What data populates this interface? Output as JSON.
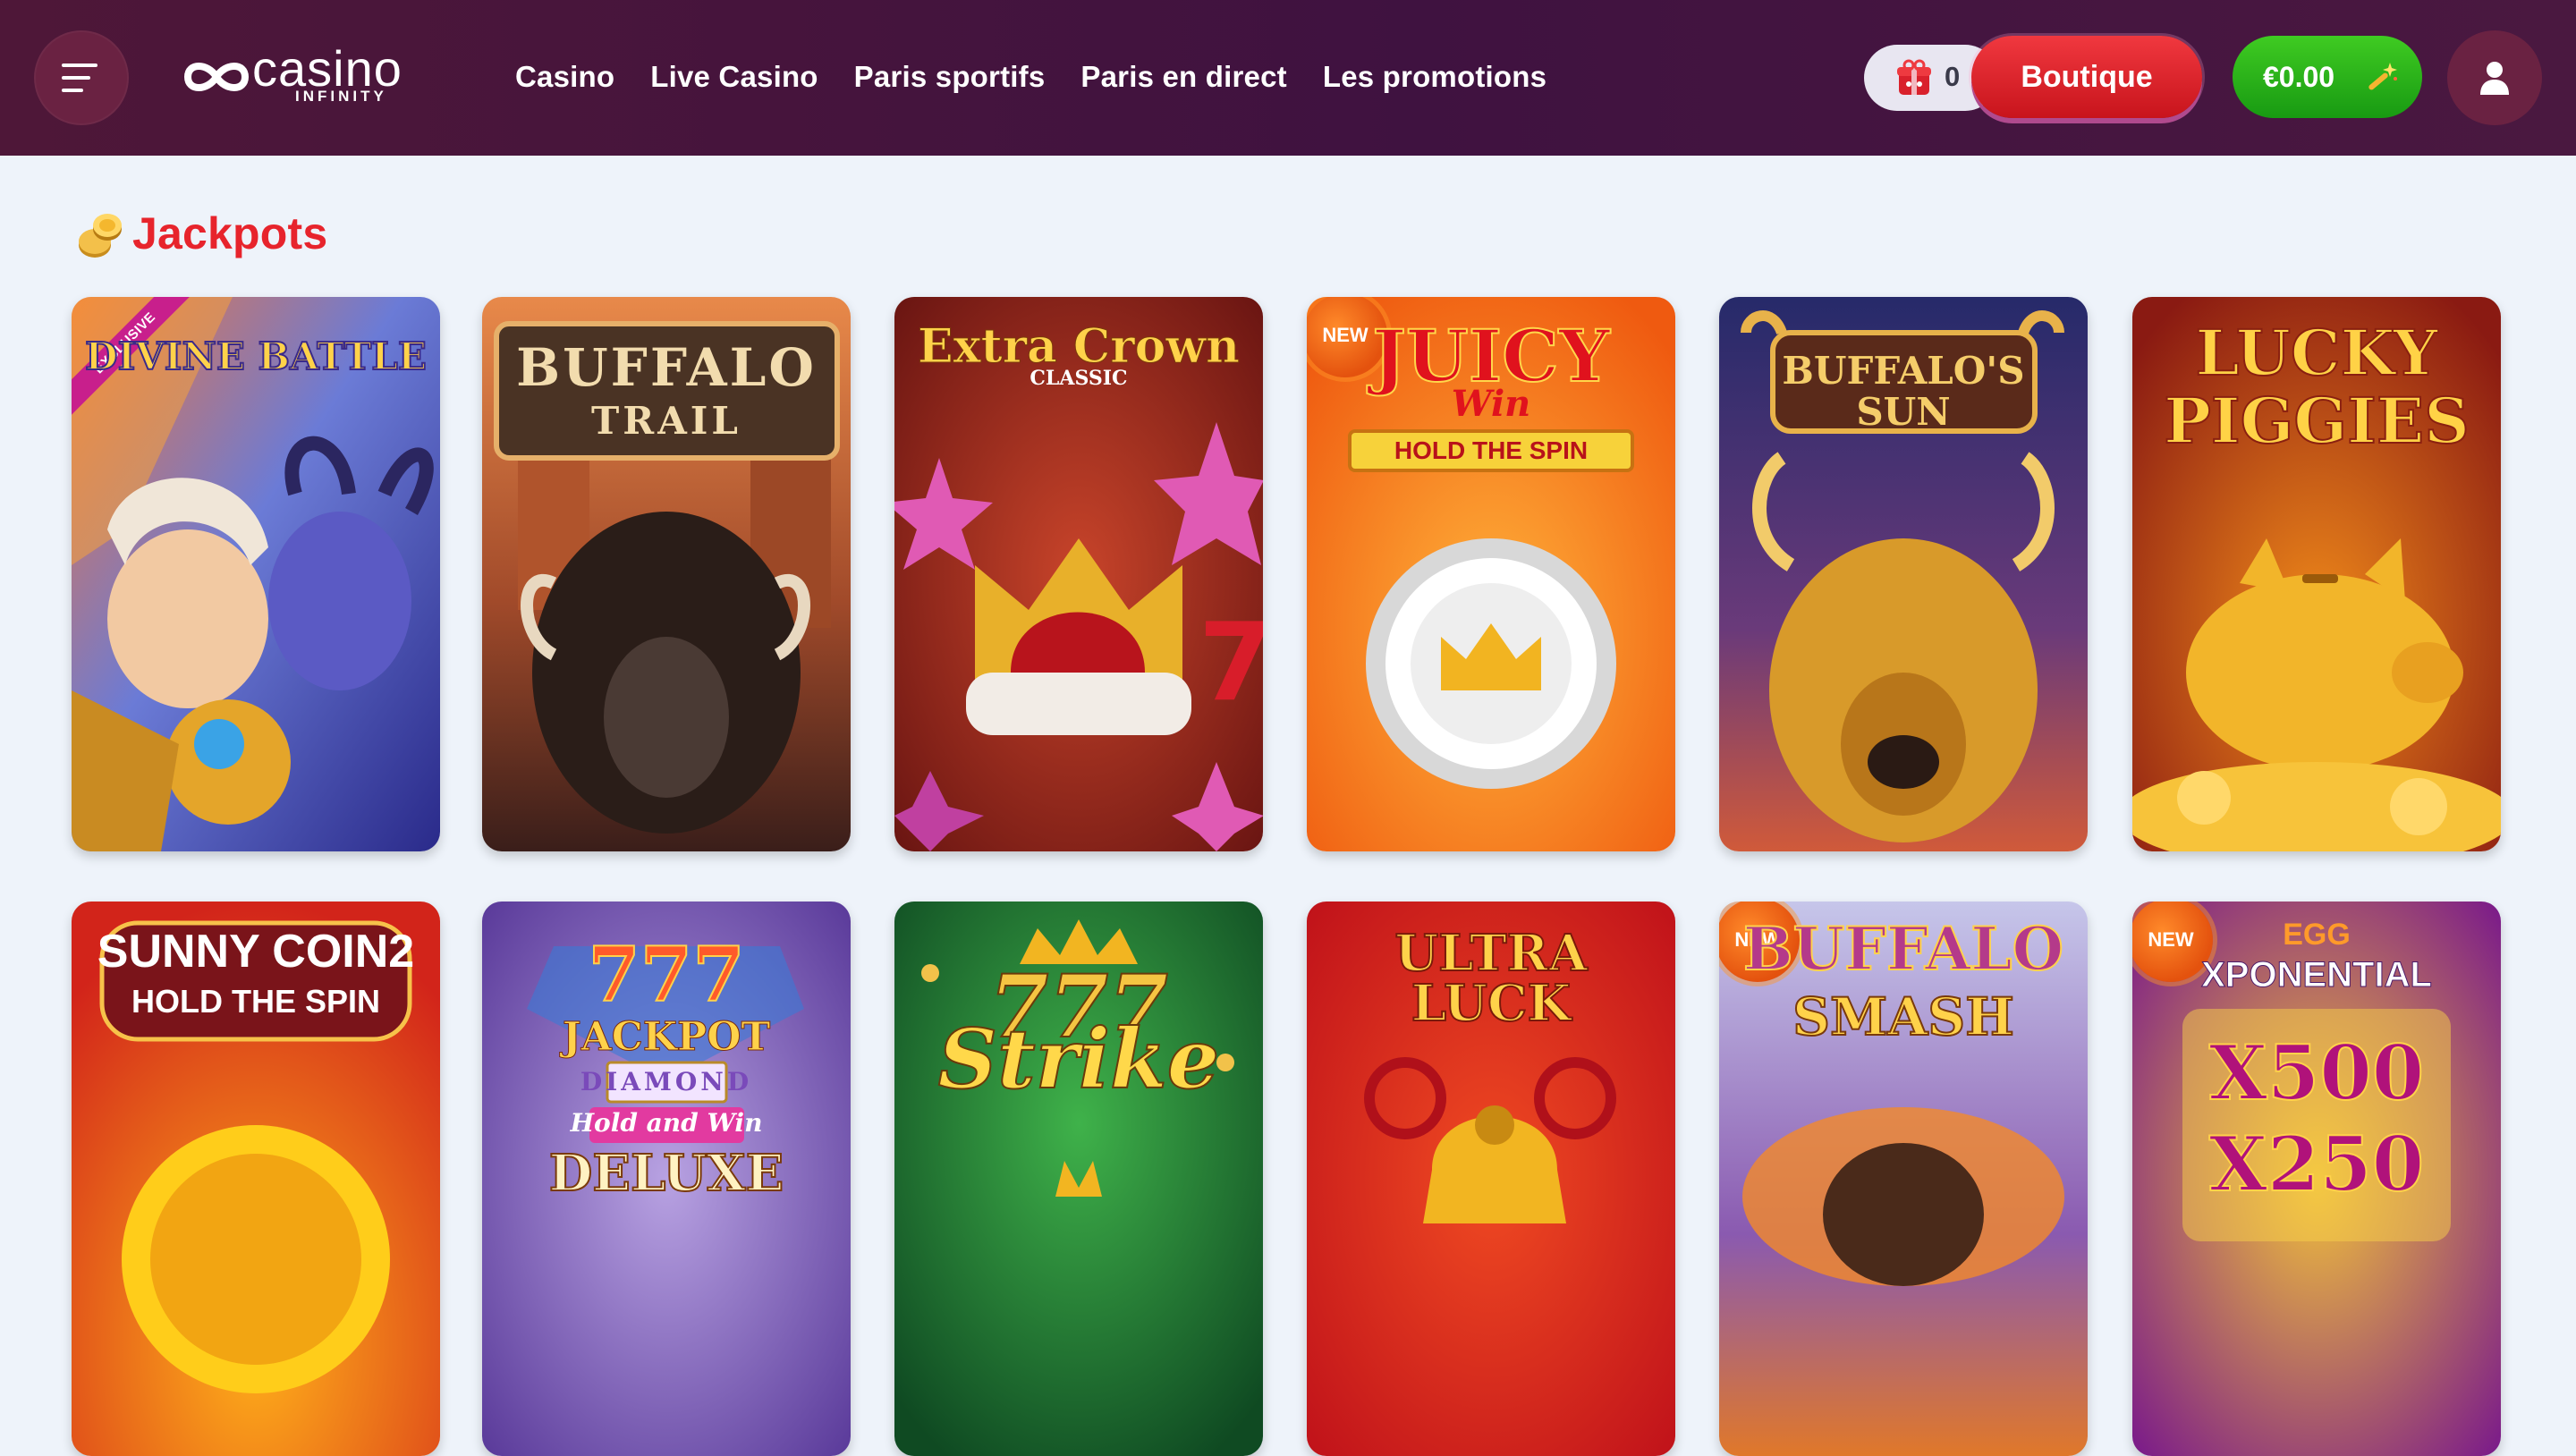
{
  "header": {
    "logo_main": "casino",
    "logo_sub": "INFINITY",
    "nav": [
      "Casino",
      "Live Casino",
      "Paris sportifs",
      "Paris en direct",
      "Les promotions"
    ],
    "coins_count": "0",
    "boutique_label": "Boutique",
    "balance": "€0.00"
  },
  "section": {
    "title": "Jackpots"
  },
  "games": [
    {
      "title": "DIVINE BATTLE",
      "badge": "EXCLUSIVE"
    },
    {
      "title": "BUFFALO",
      "subtitle": "TRAIL"
    },
    {
      "title": "Extra Crown",
      "subtitle": "CLASSIC"
    },
    {
      "title": "JUICY",
      "subtitle": "Win",
      "tagline": "HOLD THE SPIN",
      "badge": "NEW"
    },
    {
      "title": "BUFFALO'S",
      "subtitle": "SUN"
    },
    {
      "title": "LUCKY",
      "subtitle": "PIGGIES"
    },
    {
      "title": "SUNNY COIN2",
      "subtitle": "HOLD THE SPIN"
    },
    {
      "title": "777",
      "subtitle": "JACKPOT",
      "line3": "DIAMOND",
      "line4": "Hold and Win",
      "line5": "DELUXE"
    },
    {
      "title": "777",
      "subtitle": "Strike"
    },
    {
      "title": "ULTRA LUCK"
    },
    {
      "title": "BUFFALO",
      "subtitle": "SMASH",
      "badge": "NEW"
    },
    {
      "title": "EGG",
      "subtitle": "XPONENTIAL",
      "line3": "X500",
      "line4": "X250",
      "badge": "NEW"
    }
  ],
  "colors": {
    "header_bg": "#4a1540",
    "accent_red": "#e7242c",
    "balance_green": "#22ad16",
    "page_bg": "#eef3fa"
  },
  "icons": [
    "menu-icon",
    "infinity-logo-icon",
    "gift-box-icon",
    "magic-wand-icon",
    "user-icon",
    "coins-icon"
  ]
}
